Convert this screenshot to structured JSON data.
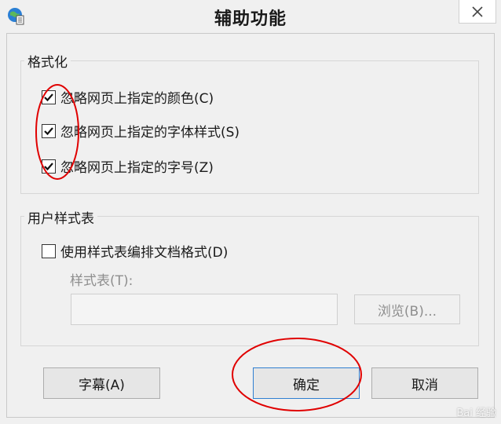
{
  "window": {
    "title": "辅助功能",
    "icon": "ie-globe-icon",
    "close_glyph": "✕"
  },
  "formatting": {
    "group_title": "格式化",
    "options": [
      {
        "label": "忽略网页上指定的颜色(C)",
        "checked": true
      },
      {
        "label": "忽略网页上指定的字体样式(S)",
        "checked": true
      },
      {
        "label": "忽略网页上指定的字号(Z)",
        "checked": true
      }
    ]
  },
  "user_stylesheet": {
    "group_title": "用户样式表",
    "use_label": "使用样式表编排文档格式(D)",
    "use_checked": false,
    "stylesheet_label": "样式表(T):",
    "stylesheet_value": "",
    "browse_label": "浏览(B)..."
  },
  "buttons": {
    "captions": "字幕(A)",
    "ok": "确定",
    "cancel": "取消"
  },
  "annotations": {
    "color": "#e00000"
  },
  "watermark": {
    "text": "Bai 经验"
  }
}
